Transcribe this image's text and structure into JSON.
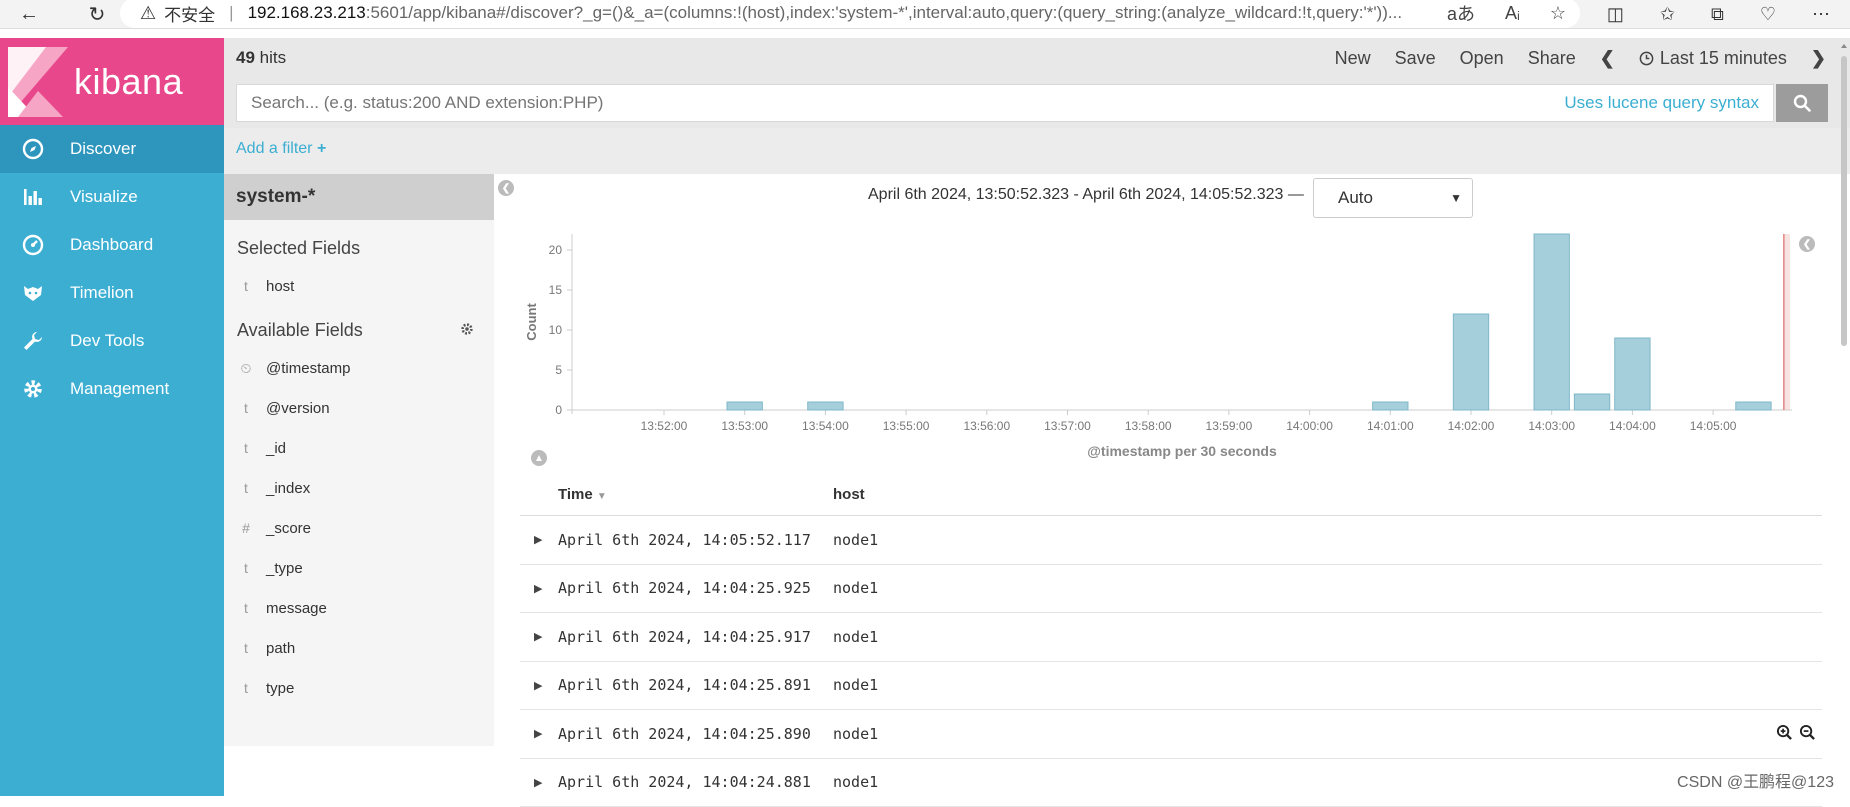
{
  "browser": {
    "insecure_label": "不安全",
    "url_host": "192.168.23.213",
    "url_rest": ":5601/app/kibana#/discover?_g=()&_a=(columns:!(host),index:'system-*',interval:auto,query:(query_string:(analyze_wildcard:!t,query:'*'))...",
    "icons": [
      "back-arrow-icon",
      "reload-icon",
      "warning-icon",
      "read-aloud-icon",
      "text-size-icon",
      "favorite-star-icon",
      "split-screen-icon",
      "favorites-icon",
      "collections-icon",
      "health-icon",
      "more-icon"
    ]
  },
  "app": {
    "logo_text": "kibana",
    "brand_color": "#e8488b",
    "sidebar_color": "#3caed2"
  },
  "sidebar": {
    "items": [
      {
        "label": "Discover",
        "icon": "compass-icon",
        "active": true
      },
      {
        "label": "Visualize",
        "icon": "bar-chart-icon"
      },
      {
        "label": "Dashboard",
        "icon": "dashboard-icon"
      },
      {
        "label": "Timelion",
        "icon": "timelion-icon"
      },
      {
        "label": "Dev Tools",
        "icon": "wrench-icon"
      },
      {
        "label": "Management",
        "icon": "gear-icon"
      }
    ]
  },
  "topbar": {
    "hits_count": "49",
    "hits_label": "hits",
    "actions": {
      "new": "New",
      "save": "Save",
      "open": "Open",
      "share": "Share"
    },
    "time_label": "Last 15 minutes"
  },
  "search": {
    "placeholder": "Search... (e.g. status:200 AND extension:PHP)",
    "lucene_link": "Uses lucene query syntax"
  },
  "filter": {
    "add_label": "Add a filter",
    "plus": "+"
  },
  "fields": {
    "index_pattern": "system-*",
    "selected_title": "Selected Fields",
    "selected": [
      {
        "type": "t",
        "name": "host"
      }
    ],
    "available_title": "Available Fields",
    "available": [
      {
        "type": "⏲",
        "name": "@timestamp"
      },
      {
        "type": "t",
        "name": "@version"
      },
      {
        "type": "t",
        "name": "_id"
      },
      {
        "type": "t",
        "name": "_index"
      },
      {
        "type": "#",
        "name": "_score"
      },
      {
        "type": "t",
        "name": "_type"
      },
      {
        "type": "t",
        "name": "message"
      },
      {
        "type": "t",
        "name": "path"
      },
      {
        "type": "t",
        "name": "type"
      }
    ]
  },
  "histogram": {
    "range_text": "April 6th 2024, 13:50:52.323 - April 6th 2024, 14:05:52.323 —",
    "interval_selected": "Auto"
  },
  "chart_data": {
    "type": "bar",
    "ylabel": "Count",
    "xlabel": "@timestamp per 30 seconds",
    "ylim": [
      0,
      22
    ],
    "yticks": [
      0,
      5,
      10,
      15,
      20
    ],
    "xticks": [
      "13:52:00",
      "13:53:00",
      "13:54:00",
      "13:55:00",
      "13:56:00",
      "13:57:00",
      "13:58:00",
      "13:59:00",
      "14:00:00",
      "14:01:00",
      "14:02:00",
      "14:03:00",
      "14:04:00",
      "14:05:00"
    ],
    "bar_color": "#a6cfdc",
    "bars": [
      {
        "x": "13:53:00",
        "value": 1
      },
      {
        "x": "13:54:00",
        "value": 1
      },
      {
        "x": "14:01:00",
        "value": 1
      },
      {
        "x": "14:02:00",
        "value": 12
      },
      {
        "x": "14:03:00",
        "value": 22
      },
      {
        "x": "14:03:30",
        "value": 2
      },
      {
        "x": "14:04:00",
        "value": 9
      },
      {
        "x": "14:05:30",
        "value": 1
      }
    ]
  },
  "table": {
    "columns": [
      "Time",
      "host"
    ],
    "rows": [
      {
        "time": "April 6th 2024, 14:05:52.117",
        "host": "node1"
      },
      {
        "time": "April 6th 2024, 14:04:25.925",
        "host": "node1"
      },
      {
        "time": "April 6th 2024, 14:04:25.917",
        "host": "node1"
      },
      {
        "time": "April 6th 2024, 14:04:25.891",
        "host": "node1"
      },
      {
        "time": "April 6th 2024, 14:04:25.890",
        "host": "node1"
      },
      {
        "time": "April 6th 2024, 14:04:24.881",
        "host": "node1"
      }
    ]
  },
  "watermark": "CSDN @王鹏程@123"
}
